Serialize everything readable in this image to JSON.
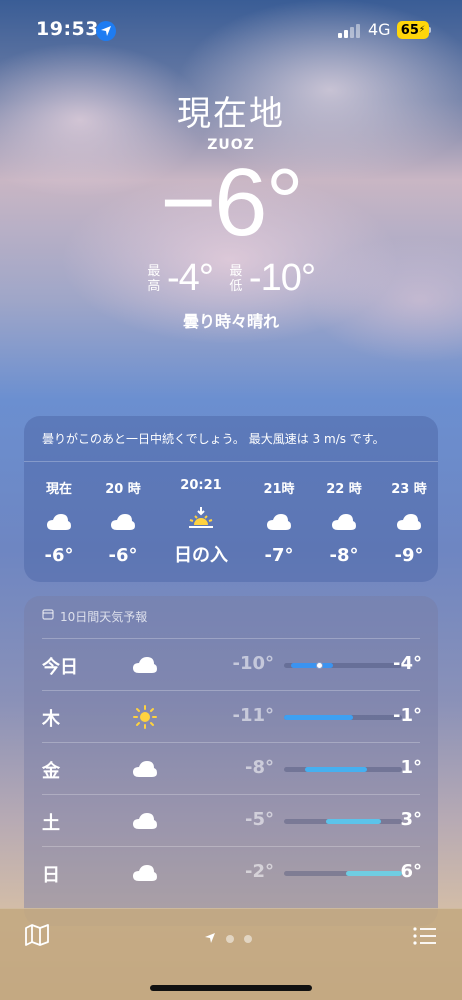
{
  "status_bar": {
    "time": "19:53",
    "network": "4G",
    "battery": "65"
  },
  "header": {
    "location": "現在地",
    "subtitle": "ZUOZ",
    "temperature": "−6°",
    "high_label": "最高",
    "high_value": "-4°",
    "low_label": "最低",
    "low_value": "-10°",
    "condition": "曇り時々晴れ"
  },
  "hourly": {
    "summary": "曇りがこのあと一日中続くでしょう。 最大風速は 3 m/s です。",
    "items": [
      {
        "label": "現在",
        "icon": "cloud-icon",
        "value": "-6°"
      },
      {
        "label": "20 時",
        "icon": "cloud-icon",
        "value": "-6°"
      },
      {
        "label": "20:21",
        "icon": "sunset-icon",
        "value": "日の入"
      },
      {
        "label": "21時",
        "icon": "cloud-icon",
        "value": "-7°"
      },
      {
        "label": "22 時",
        "icon": "cloud-icon",
        "value": "-8°"
      },
      {
        "label": "23 時",
        "icon": "cloud-icon",
        "value": "-9°"
      }
    ]
  },
  "daily": {
    "title": "10日間天気予報",
    "range_min": -11,
    "range_max": 6,
    "days": [
      {
        "name": "今日",
        "icon": "cloud-icon",
        "low": "-10°",
        "high": "-4°",
        "low_num": -10,
        "high_num": -4,
        "current_num": -6,
        "bar_color": "#3b93f0"
      },
      {
        "name": "木",
        "icon": "sun-icon",
        "low": "-11°",
        "high": "-1°",
        "low_num": -11,
        "high_num": -1,
        "bar_color": "#3da0f2"
      },
      {
        "name": "金",
        "icon": "cloud-icon",
        "low": "-8°",
        "high": "1°",
        "low_num": -8,
        "high_num": 1,
        "bar_color": "#46b0f0"
      },
      {
        "name": "土",
        "icon": "cloud-icon",
        "low": "-5°",
        "high": "3°",
        "low_num": -5,
        "high_num": 3,
        "bar_color": "#5cc3ea"
      },
      {
        "name": "日",
        "icon": "cloud-icon",
        "low": "-2°",
        "high": "6°",
        "low_num": -2,
        "high_num": 6,
        "bar_color": "#6fcde2"
      }
    ]
  }
}
